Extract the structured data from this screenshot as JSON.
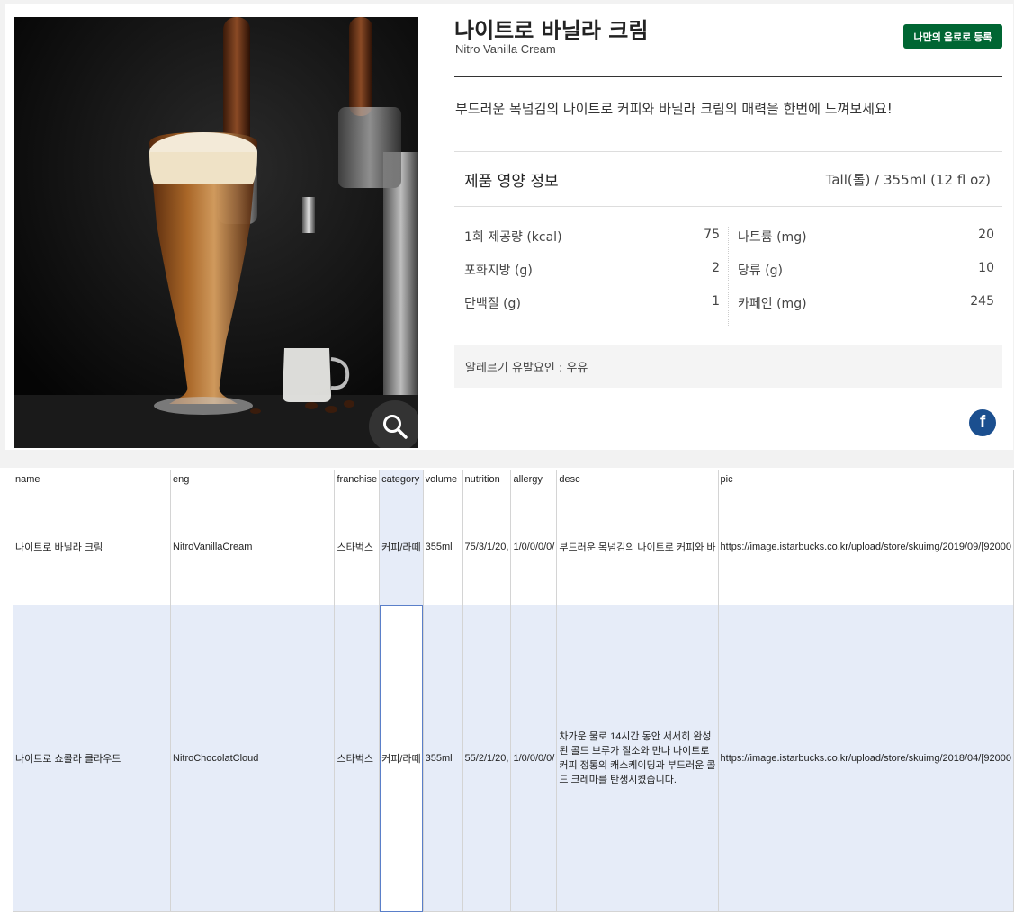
{
  "product": {
    "name_ko": "나이트로 바닐라 크림",
    "name_en": "Nitro Vanilla Cream",
    "register_label": "나만의 음료로 등록",
    "description": "부드러운 목넘김의 나이트로 커피와 바닐라 크림의 매력을 한번에 느껴보세요!",
    "nutrition_title": "제품 영양 정보",
    "size": "Tall(톨) / 355ml (12 fl oz)",
    "nutrition_left": [
      {
        "label": "1회 제공량 (kcal)",
        "value": "75"
      },
      {
        "label": "포화지방 (g)",
        "value": "2"
      },
      {
        "label": "단백질 (g)",
        "value": "1"
      }
    ],
    "nutrition_right": [
      {
        "label": "나트륨 (mg)",
        "value": "20"
      },
      {
        "label": "당류 (g)",
        "value": "10"
      },
      {
        "label": "카페인 (mg)",
        "value": "245"
      }
    ],
    "allergy": "알레르기 유발요인 : 우유",
    "icons": {
      "zoom": "search-icon",
      "share": "facebook-icon"
    },
    "colors": {
      "accent": "#006633",
      "facebook": "#1b4f8f"
    }
  },
  "sheet": {
    "headers": [
      "name",
      "eng",
      "franchise",
      "category",
      "volume",
      "nutrition",
      "allergy",
      "desc",
      "pic"
    ],
    "rows": [
      {
        "name": "나이트로 바닐라 크림",
        "eng": "NitroVanillaCream",
        "franchise": "스타벅스",
        "category": "커피/라떼",
        "volume": "355ml",
        "nutrition": "75/3/1/20,",
        "allergy": "1/0/0/0/0/",
        "desc": "부드러운 목넘김의 나이트로 커피와 바",
        "pic": "https://image.istarbucks.co.kr/upload/store/skuimg/2019/09/[92000"
      },
      {
        "name": "나이트로 쇼콜라 클라우드",
        "eng": "NitroChocolatCloud",
        "franchise": "스타벅스",
        "category": "커피/라떼",
        "volume": "355ml",
        "nutrition": "55/2/1/20,",
        "allergy": "1/0/0/0/0/",
        "desc": "차가운 물로 14시간 동안 서서히 완성된 콜드 브루가 질소와 만나 나이트로 커피 정통의 캐스케이딩과 부드러운 콜드 크레마를 탄생시켰습니다.",
        "pic": "https://image.istarbucks.co.kr/upload/store/skuimg/2018/04/[92000"
      }
    ]
  }
}
